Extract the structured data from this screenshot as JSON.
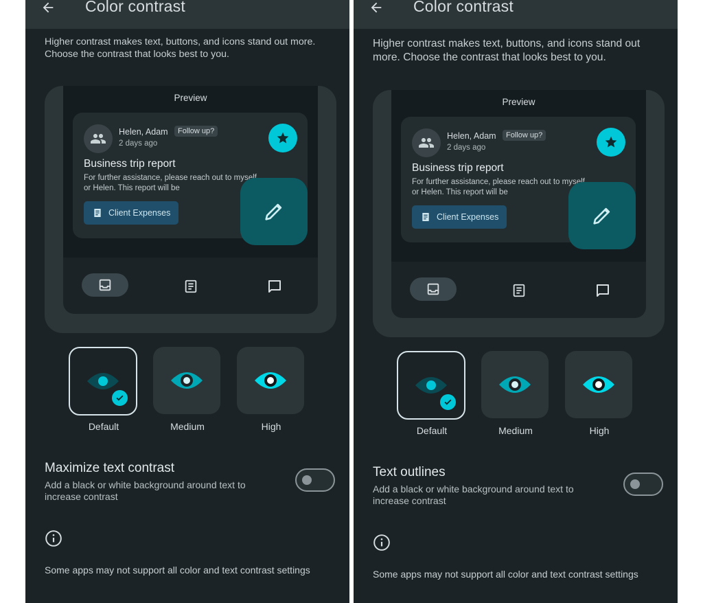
{
  "screens": [
    {
      "title": "Color contrast",
      "description": "Higher contrast makes text, buttons, and icons stand out more. Choose the contrast that looks best to you.",
      "preview": {
        "label": "Preview",
        "sender": "Helen, Adam",
        "chip": "Follow up?",
        "time": "2 days ago",
        "subject": "Business trip report",
        "snippet": "For further assistance, please reach out to myself or Helen. This report will be",
        "button": "Client Expenses"
      },
      "options": [
        {
          "label": "Default",
          "selected": true
        },
        {
          "label": "Medium",
          "selected": false
        },
        {
          "label": "High",
          "selected": false
        }
      ],
      "toggle": {
        "title": "Maximize text contrast",
        "subtitle": "Add a black or white background around text to increase contrast",
        "on": false
      },
      "footer": "Some apps may not support all color and text contrast settings"
    },
    {
      "title": "Color contrast",
      "description": "Higher contrast makes text, buttons, and icons stand out more. Choose the contrast that looks best to you.",
      "preview": {
        "label": "Preview",
        "sender": "Helen, Adam",
        "chip": "Follow up?",
        "time": "2 days ago",
        "subject": "Business trip report",
        "snippet": "For further assistance, please reach out to myself or Helen. This report will be",
        "button": "Client Expenses"
      },
      "options": [
        {
          "label": "Default",
          "selected": true
        },
        {
          "label": "Medium",
          "selected": false
        },
        {
          "label": "High",
          "selected": false
        }
      ],
      "toggle": {
        "title": "Text outlines",
        "subtitle": "Add a black or white background around text to increase contrast",
        "on": false
      },
      "footer": "Some apps may not support all color and text contrast settings"
    }
  ],
  "colors": {
    "accent": "#00c8d8",
    "background": "#1b2326",
    "surface": "#2c3538",
    "fab": "#0c5b63"
  },
  "icons": [
    "back-arrow-icon",
    "people-icon",
    "star-icon",
    "document-icon",
    "pencil-icon",
    "inbox-icon",
    "article-icon",
    "chat-icon",
    "eye-icon",
    "check-icon",
    "info-icon"
  ]
}
